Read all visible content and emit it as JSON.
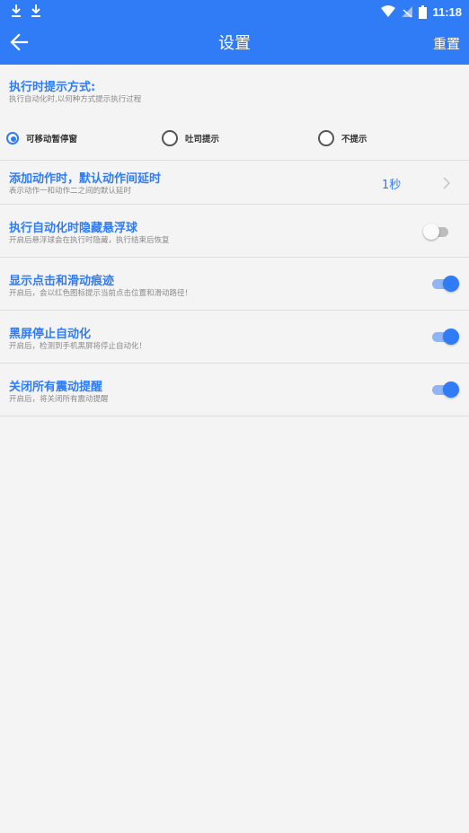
{
  "status_bar": {
    "time": "11:18"
  },
  "app_bar": {
    "title": "设置",
    "reset_label": "重置"
  },
  "prompt_mode": {
    "title": "执行时提示方式:",
    "subtitle": "执行自动化时,以何种方式提示执行过程",
    "options": [
      {
        "label": "可移动暂停窗",
        "selected": true
      },
      {
        "label": "吐司提示",
        "selected": false
      },
      {
        "label": "不提示",
        "selected": false
      }
    ]
  },
  "default_delay": {
    "title": "添加动作时，默认动作间延时",
    "subtitle": "表示动作一和动作二之间的默认延时",
    "value": "1秒"
  },
  "hide_float": {
    "title": "执行自动化时隐藏悬浮球",
    "subtitle": "开启后悬浮球会在执行时隐藏，执行结束后恢复",
    "enabled": false
  },
  "show_trace": {
    "title": "显示点击和滑动痕迹",
    "subtitle": "开启后，会以红色图标提示当前点击位置和滑动路径！",
    "enabled": true
  },
  "black_screen": {
    "title": "黑屏停止自动化",
    "subtitle": "开启后，检测到手机黑屏将停止自动化！",
    "enabled": true
  },
  "vibration": {
    "title": "关闭所有震动提醒",
    "subtitle": "开启后，将关闭所有震动提醒",
    "enabled": true
  },
  "colors": {
    "accent": "#2f7cf6",
    "background": "#f4f4f4",
    "divider": "#dedede"
  }
}
